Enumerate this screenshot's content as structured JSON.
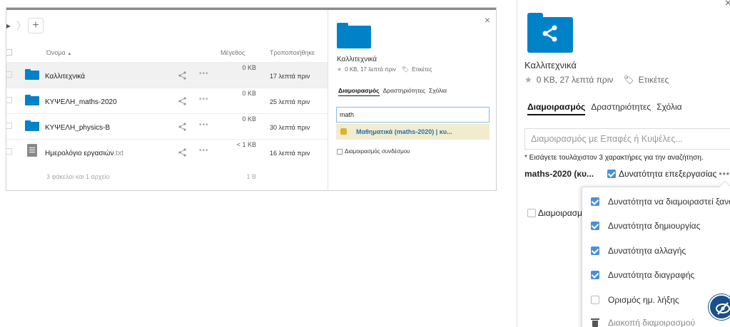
{
  "left": {
    "breadcrumb_add": "+",
    "columns": {
      "name": "Όνομα",
      "sort": "▲",
      "size": "Μέγεθος",
      "modified": "Τροποποιήθηκε"
    },
    "files": [
      {
        "name": "Καλλιτεχνικά",
        "ext": "",
        "type": "folder",
        "size": "0 KB",
        "modified": "17 λεπτά πριν"
      },
      {
        "name": "ΚΥΨΕΛΗ_maths-2020",
        "ext": "",
        "type": "folder",
        "size": "0 KB",
        "modified": "25 λεπτά πριν"
      },
      {
        "name": "ΚΥΨΕΛΗ_physics-B",
        "ext": "",
        "type": "folder",
        "size": "0 KB",
        "modified": "30 λεπτά πριν"
      },
      {
        "name": "Ημερολόγιο εργασιών",
        "ext": ".txt",
        "type": "file",
        "size": "< 1 KB",
        "modified": "16 λεπτά πριν"
      }
    ],
    "summary": {
      "count": "3 φάκελοι και 1 αρχείο",
      "total": "1 B"
    },
    "sidebar": {
      "close": "×",
      "title": "Καλλιτεχνικά",
      "meta": "0 KB, 17 λεπτά πριν",
      "tags": "Ετικέτες",
      "tabs": [
        "Διαμοιρασμός",
        "Δραστηριότητες",
        "Σχόλια"
      ],
      "search_value": "math",
      "suggestion": "Μαθηματικά (maths-2020) | κυ...",
      "link_share": "Διαμοιρασμός συνδέσμου"
    }
  },
  "right": {
    "close": "×",
    "title": "Καλλιτεχνικά",
    "meta": "0 KB, 27 λεπτά πριν",
    "tags": "Ετικέτες",
    "tabs": [
      "Διαμοιρασμός",
      "Δραστηριότητες",
      "Σχόλια"
    ],
    "share_placeholder": "Διαμοιρασμός με Επαφές ή Κυψέλες...",
    "hint": "* Εισάγετε τουλάχιστον 3 χαρακτήρες για την αναζήτηση.",
    "recipient": "maths-2020 (κυ...",
    "can_edit": "Δυνατότητα επεξεργασίας",
    "more": "•••",
    "link_share": "Διαμοιρασμ",
    "menu": [
      {
        "label": "Δυνατότητα να διαμοιραστεί ξανά",
        "checked": true
      },
      {
        "label": "Δυνατότητα δημιουργίας",
        "checked": true
      },
      {
        "label": "Δυνατότητα αλλαγής",
        "checked": true
      },
      {
        "label": "Δυνατότητα διαγραφής",
        "checked": true
      },
      {
        "label": "Ορισμός ημ. λήξης",
        "checked": false
      },
      {
        "label": "Διακοπή διαμοιρασμού",
        "checked": null
      }
    ]
  }
}
